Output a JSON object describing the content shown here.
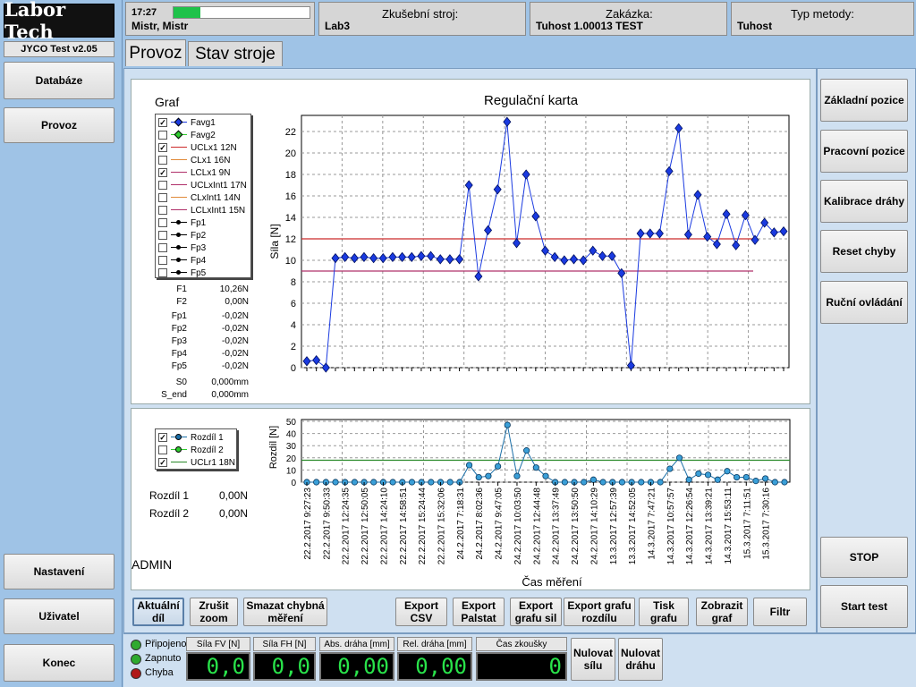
{
  "app": {
    "logo": "Labor Tech",
    "version": "JYCO Test v2.05",
    "time": "17:27",
    "user": "Mistr, Mistr",
    "progress": 0.2
  },
  "header": {
    "machine_label": "Zkušební stroj:",
    "machine_value": "Lab3",
    "order_label": "Zakázka:",
    "order_value": "Tuhost 1.00013 TEST",
    "method_label": "Typ metody:",
    "method_value": "Tuhost"
  },
  "sidebar": {
    "items": [
      {
        "label": "Databáze"
      },
      {
        "label": "Provoz"
      },
      {
        "label": "Nastavení"
      },
      {
        "label": "Uživatel"
      },
      {
        "label": "Konec"
      }
    ]
  },
  "tabs": [
    {
      "label": "Provoz",
      "active": true
    },
    {
      "label": "Stav stroje",
      "active": false
    }
  ],
  "right_panel": {
    "buttons": [
      {
        "label": "Základní  pozice"
      },
      {
        "label": "Pracovní pozice"
      },
      {
        "label": "Kalibrace dráhy"
      },
      {
        "label": "Reset chyby"
      },
      {
        "label": "Ruční ovládání"
      }
    ],
    "stop": "STOP",
    "start": "Start test"
  },
  "graph_panel": {
    "label": "Graf",
    "legend": [
      {
        "name": "Favg1",
        "checked": true,
        "color": "#1a3ae0",
        "marker": "diamond"
      },
      {
        "name": "Favg2",
        "checked": false,
        "color": "#2ecc2e",
        "marker": "diamond"
      },
      {
        "name": "UCLx1 12N",
        "checked": true,
        "color": "#cc2a2a",
        "marker": "line"
      },
      {
        "name": "CLx1 16N",
        "checked": false,
        "color": "#e08a3a",
        "marker": "line"
      },
      {
        "name": "LCLx1 9N",
        "checked": true,
        "color": "#b0306a",
        "marker": "line"
      },
      {
        "name": "UCLxInt1 17N",
        "checked": false,
        "color": "#b0306a",
        "marker": "line"
      },
      {
        "name": "CLxInt1 14N",
        "checked": false,
        "color": "#e08a3a",
        "marker": "line"
      },
      {
        "name": "LCLxInt1 15N",
        "checked": false,
        "color": "#b0306a",
        "marker": "line"
      },
      {
        "name": "Fp1",
        "checked": false,
        "color": "#000000",
        "marker": "dot"
      },
      {
        "name": "Fp2",
        "checked": false,
        "color": "#000000",
        "marker": "dot"
      },
      {
        "name": "Fp3",
        "checked": false,
        "color": "#000000",
        "marker": "dot"
      },
      {
        "name": "Fp4",
        "checked": false,
        "color": "#000000",
        "marker": "dot"
      },
      {
        "name": "Fp5",
        "checked": false,
        "color": "#000000",
        "marker": "dot"
      }
    ],
    "values": [
      {
        "name": "F1",
        "value": "10,26N"
      },
      {
        "name": "F2",
        "value": "0,00N"
      },
      {
        "name": "Fp1",
        "value": "-0,02N"
      },
      {
        "name": "Fp2",
        "value": "-0,02N"
      },
      {
        "name": "Fp3",
        "value": "-0,02N"
      },
      {
        "name": "Fp4",
        "value": "-0,02N"
      },
      {
        "name": "Fp5",
        "value": "-0,02N"
      },
      {
        "name": "S0",
        "value": "0,000mm"
      },
      {
        "name": "S_end",
        "value": "0,000mm"
      }
    ]
  },
  "diff_panel": {
    "legend": [
      {
        "name": "Rozdíl 1",
        "checked": true,
        "color": "#1a6fa8",
        "marker": "circle"
      },
      {
        "name": "Rozdíl 2",
        "checked": false,
        "color": "#2ecc2e",
        "marker": "circle"
      },
      {
        "name": "UCLr1 18N",
        "checked": true,
        "color": "#2a8a2a",
        "marker": "line"
      }
    ],
    "values": [
      {
        "name": "Rozdíl 1",
        "value": "0,00N"
      },
      {
        "name": "Rozdíl 2",
        "value": "0,00N"
      }
    ],
    "user": "ADMIN"
  },
  "chart_data": [
    {
      "type": "line",
      "title": "Regulační karta",
      "ylabel": "Síla [N]",
      "ylim": [
        0,
        23
      ],
      "yticks": [
        0,
        2,
        4,
        6,
        8,
        10,
        12,
        14,
        16,
        18,
        20,
        22
      ],
      "grid": true,
      "series": [
        {
          "name": "Favg1",
          "color": "#1a3ae0",
          "values": [
            0.6,
            0.7,
            0.0,
            10.2,
            10.3,
            10.2,
            10.3,
            10.2,
            10.2,
            10.3,
            10.3,
            10.3,
            10.4,
            10.4,
            10.1,
            10.1,
            10.1,
            17.0,
            8.5,
            12.8,
            16.6,
            22.9,
            11.6,
            18.0,
            14.1,
            10.9,
            10.3,
            10.0,
            10.1,
            10.0,
            10.9,
            10.4,
            10.4,
            8.8,
            0.2,
            12.5,
            12.5,
            12.5,
            18.3,
            22.3,
            12.4,
            16.1,
            12.2,
            11.5,
            14.3,
            11.4,
            14.2,
            11.9,
            13.5,
            12.6,
            12.7
          ]
        }
      ],
      "hlines": [
        {
          "name": "UCLx1 12N",
          "value": 12,
          "color": "#cc2a2a"
        },
        {
          "name": "LCLx1 9N",
          "value": 9,
          "color": "#b0306a"
        }
      ]
    },
    {
      "type": "line",
      "ylabel": "Rozdíl [N]",
      "xlabel": "Čas měření",
      "ylim": [
        0,
        50
      ],
      "yticks": [
        0,
        10,
        20,
        30,
        40,
        50
      ],
      "grid": true,
      "x_tick_labels": [
        "22.2.2017 9:27:23",
        "22.2.2017 9:50:33",
        "22.2.2017 12:24:35",
        "22.2.2017 12:50:05",
        "22.2.2017 14:24:10",
        "22.2.2017 14:58:51",
        "22.2.2017 15:24:44",
        "22.2.2017 15:32:06",
        "24.2.2017 7:18:31",
        "24.2.2017 8:02:36",
        "24.2.2017 9:47:05",
        "24.2.2017 10:03:50",
        "24.2.2017 12:44:48",
        "24.2.2017 13:37:49",
        "24.2.2017 13:50:50",
        "24.2.2017 14:10:29",
        "13.3.2017 12:57:39",
        "13.3.2017 14:52:05",
        "14.3.2017 7:47:21",
        "14.3.2017 10:57:57",
        "14.3.2017 12:26:54",
        "14.3.2017 13:39:21",
        "14.3.2017 15:53:11",
        "15.3.2017 7:11:51",
        "15.3.2017 7:30:16"
      ],
      "series": [
        {
          "name": "Rozdíl 1",
          "color": "#1a6fa8",
          "values": [
            0,
            0,
            0,
            0,
            0,
            0,
            0,
            0,
            0,
            0,
            0,
            0,
            0,
            0,
            0,
            0,
            0,
            14,
            4,
            5,
            13,
            47,
            5,
            26,
            12,
            5,
            0,
            0,
            0,
            0,
            2,
            0,
            0,
            0,
            0,
            0,
            0,
            0,
            11,
            20,
            2,
            7,
            6,
            2,
            9,
            4,
            4,
            1,
            3,
            0,
            0
          ]
        }
      ],
      "hlines": [
        {
          "name": "UCLr1 18N",
          "value": 18,
          "color": "#2a8a2a"
        }
      ]
    }
  ],
  "toolbar": {
    "buttons": [
      {
        "label": "Aktuální díl",
        "pressed": true
      },
      {
        "label": "Zrušit zoom"
      },
      {
        "label": "Smazat chybná měření"
      },
      {
        "label": "Export CSV"
      },
      {
        "label": "Export Palstat"
      },
      {
        "label": "Export grafu sil"
      },
      {
        "label": "Export grafu rozdílu"
      },
      {
        "label": "Tisk grafu"
      },
      {
        "label": "Zobrazit graf"
      },
      {
        "label": "Filtr"
      }
    ]
  },
  "status": {
    "leds": [
      {
        "label": "Připojeno",
        "color": "#2faa2f"
      },
      {
        "label": "Zapnuto",
        "color": "#2faa2f"
      },
      {
        "label": "Chyba",
        "color": "#b01818"
      }
    ],
    "meters": [
      {
        "label": "Síla FV [N]",
        "value": "0,0"
      },
      {
        "label": "Síla FH [N]",
        "value": "0,0"
      },
      {
        "label": "Abs. dráha [mm]",
        "value": "0,00"
      },
      {
        "label": "Rel. dráha [mm]",
        "value": "0,00"
      },
      {
        "label": "Čas zkoušky",
        "value": "0"
      }
    ],
    "reset_force": "Nulovat sílu",
    "reset_path": "Nulovat dráhu"
  }
}
